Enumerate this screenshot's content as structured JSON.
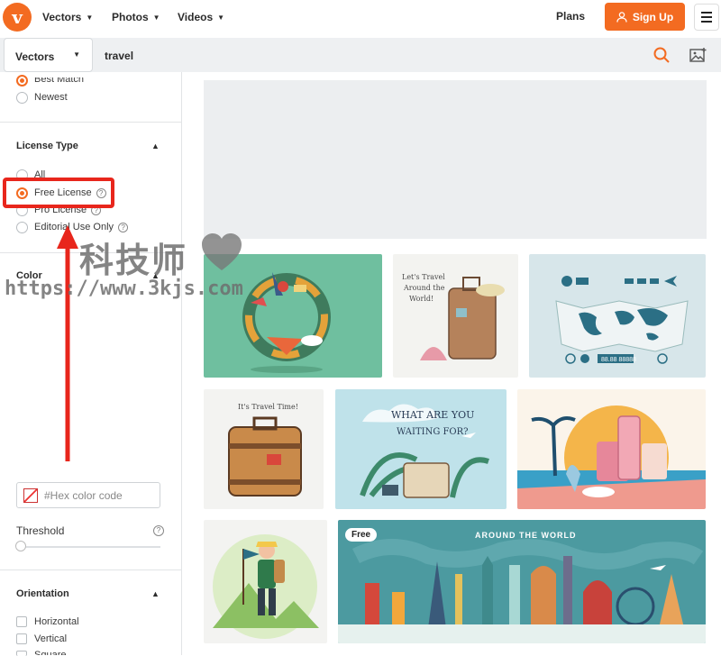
{
  "header": {
    "logo_letter": "v",
    "nav": [
      {
        "label": "Vectors"
      },
      {
        "label": "Photos"
      },
      {
        "label": "Videos"
      }
    ],
    "plans_label": "Plans",
    "signup_label": "Sign Up"
  },
  "search": {
    "type_select": "Vectors",
    "query": "travel"
  },
  "sidebar": {
    "sort_options": [
      {
        "label": "Best Match",
        "selected": true
      },
      {
        "label": "Newest",
        "selected": false
      }
    ],
    "license": {
      "title": "License Type",
      "options": [
        {
          "label": "All",
          "selected": false
        },
        {
          "label": "Free License",
          "selected": true
        },
        {
          "label": "Pro License",
          "selected": false
        },
        {
          "label": "Editorial Use Only",
          "selected": false
        }
      ]
    },
    "color": {
      "title": "Color",
      "hex_placeholder": "#Hex color code",
      "threshold_label": "Threshold",
      "threshold_value": 0
    },
    "orientation": {
      "title": "Orientation",
      "options": [
        {
          "label": "Horizontal"
        },
        {
          "label": "Vertical"
        },
        {
          "label": "Square"
        }
      ]
    }
  },
  "watermark": {
    "chinese": "科技师",
    "url": "https://www.3kjs.com"
  },
  "results": {
    "free_badge": "Free",
    "tile_texts": {
      "lets_travel": "Let's Travel Around the World!",
      "travel_time": "It's Travel Time!",
      "waiting": "WHAT ARE YOU WAITING FOR?",
      "around_world": "AROUND THE WORLD",
      "map_digits": "88.88 88888"
    }
  },
  "colors": {
    "accent": "#f36b21",
    "highlight": "#e8261c"
  }
}
